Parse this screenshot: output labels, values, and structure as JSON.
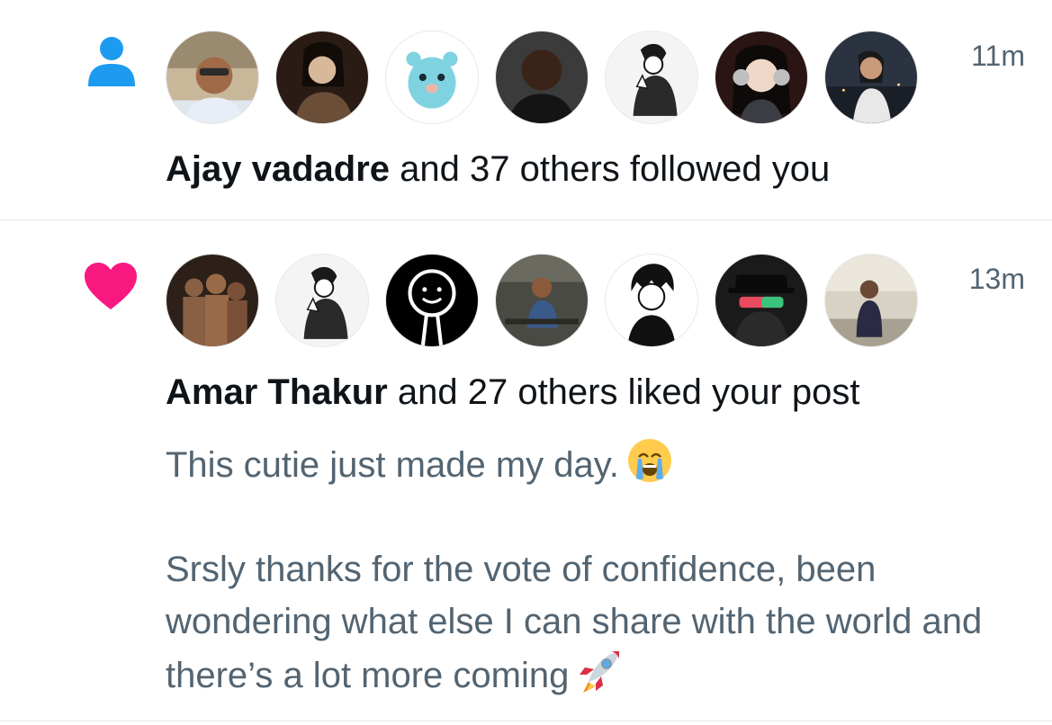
{
  "notifications": [
    {
      "type": "follow",
      "icon": "person-icon",
      "icon_color": "#1d9bf0",
      "time": "11m",
      "actor": "Ajay vadadre",
      "action": " and 37 others followed you",
      "avatar_count": 7
    },
    {
      "type": "like",
      "icon": "heart-icon",
      "icon_color": "#f91880",
      "time": "13m",
      "actor": "Amar Thakur",
      "action": " and 27 others liked your post",
      "avatar_count": 7,
      "post": {
        "line1": "This cutie just made my day.",
        "line1_emoji": "crying-face-emoji",
        "line2": "Srsly thanks for the vote of confidence, been wondering what else I can share with the world and there’s a lot more coming",
        "line2_emoji": "rocket-emoji"
      }
    }
  ],
  "colors": {
    "primary_text": "#0f1419",
    "secondary_text": "#536471",
    "divider": "#e6e6e6"
  }
}
